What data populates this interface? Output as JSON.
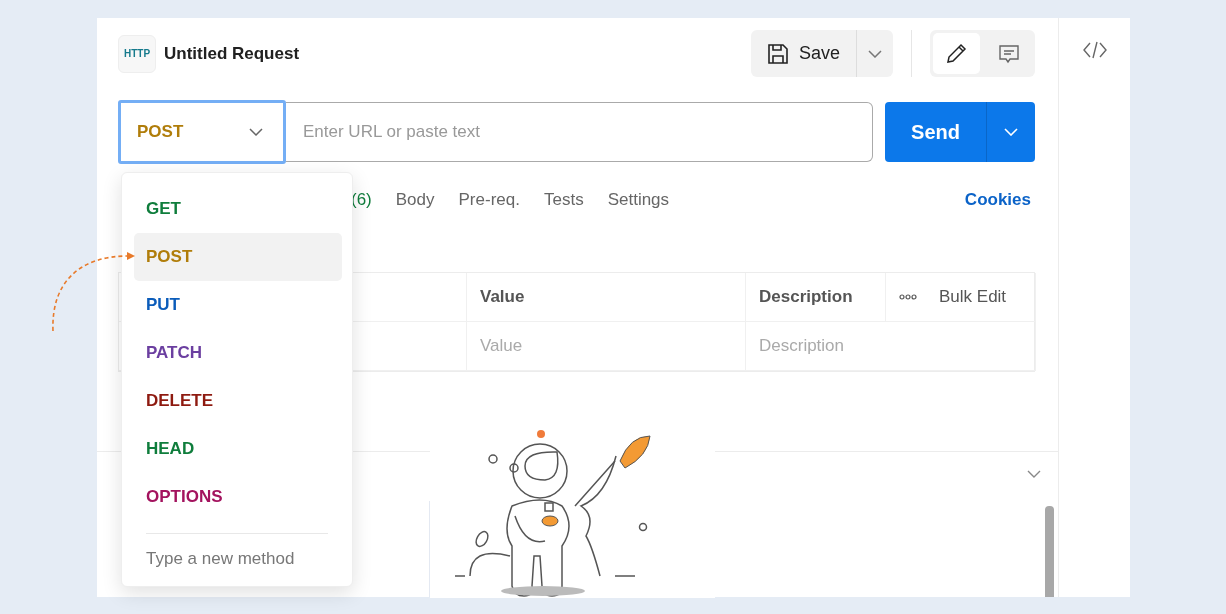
{
  "request": {
    "icon_text": "HTTP",
    "title": "Untitled Request"
  },
  "toolbar": {
    "save": "Save",
    "modes": [
      {
        "kind": "edit",
        "selected": true
      },
      {
        "kind": "comment",
        "selected": false
      }
    ]
  },
  "url_bar": {
    "method": "POST",
    "placeholder": "Enter URL or paste text",
    "send": "Send"
  },
  "tabs": [
    {
      "label": "(6)",
      "kind": "count"
    },
    {
      "label": "Body",
      "kind": "tab"
    },
    {
      "label": "Pre-req.",
      "kind": "tab"
    },
    {
      "label": "Tests",
      "kind": "tab"
    },
    {
      "label": "Settings",
      "kind": "tab"
    }
  ],
  "cookies": "Cookies",
  "table": {
    "columns": [
      "Value",
      "Description"
    ],
    "bulk_edit": "Bulk Edit",
    "rows": [
      {
        "value_placeholder": "Value",
        "description_placeholder": "Description"
      }
    ]
  },
  "method_menu": {
    "items": [
      {
        "label": "GET",
        "color": "#0f7d3c",
        "selected": false
      },
      {
        "label": "POST",
        "color": "#b07d0a",
        "selected": true
      },
      {
        "label": "PUT",
        "color": "#0b5cba",
        "selected": false
      },
      {
        "label": "PATCH",
        "color": "#6b3fa0",
        "selected": false
      },
      {
        "label": "DELETE",
        "color": "#8e1a10",
        "selected": false
      },
      {
        "label": "HEAD",
        "color": "#0f7d3c",
        "selected": false
      },
      {
        "label": "OPTIONS",
        "color": "#a3135e",
        "selected": false
      }
    ],
    "new_method_placeholder": "Type a new method"
  }
}
